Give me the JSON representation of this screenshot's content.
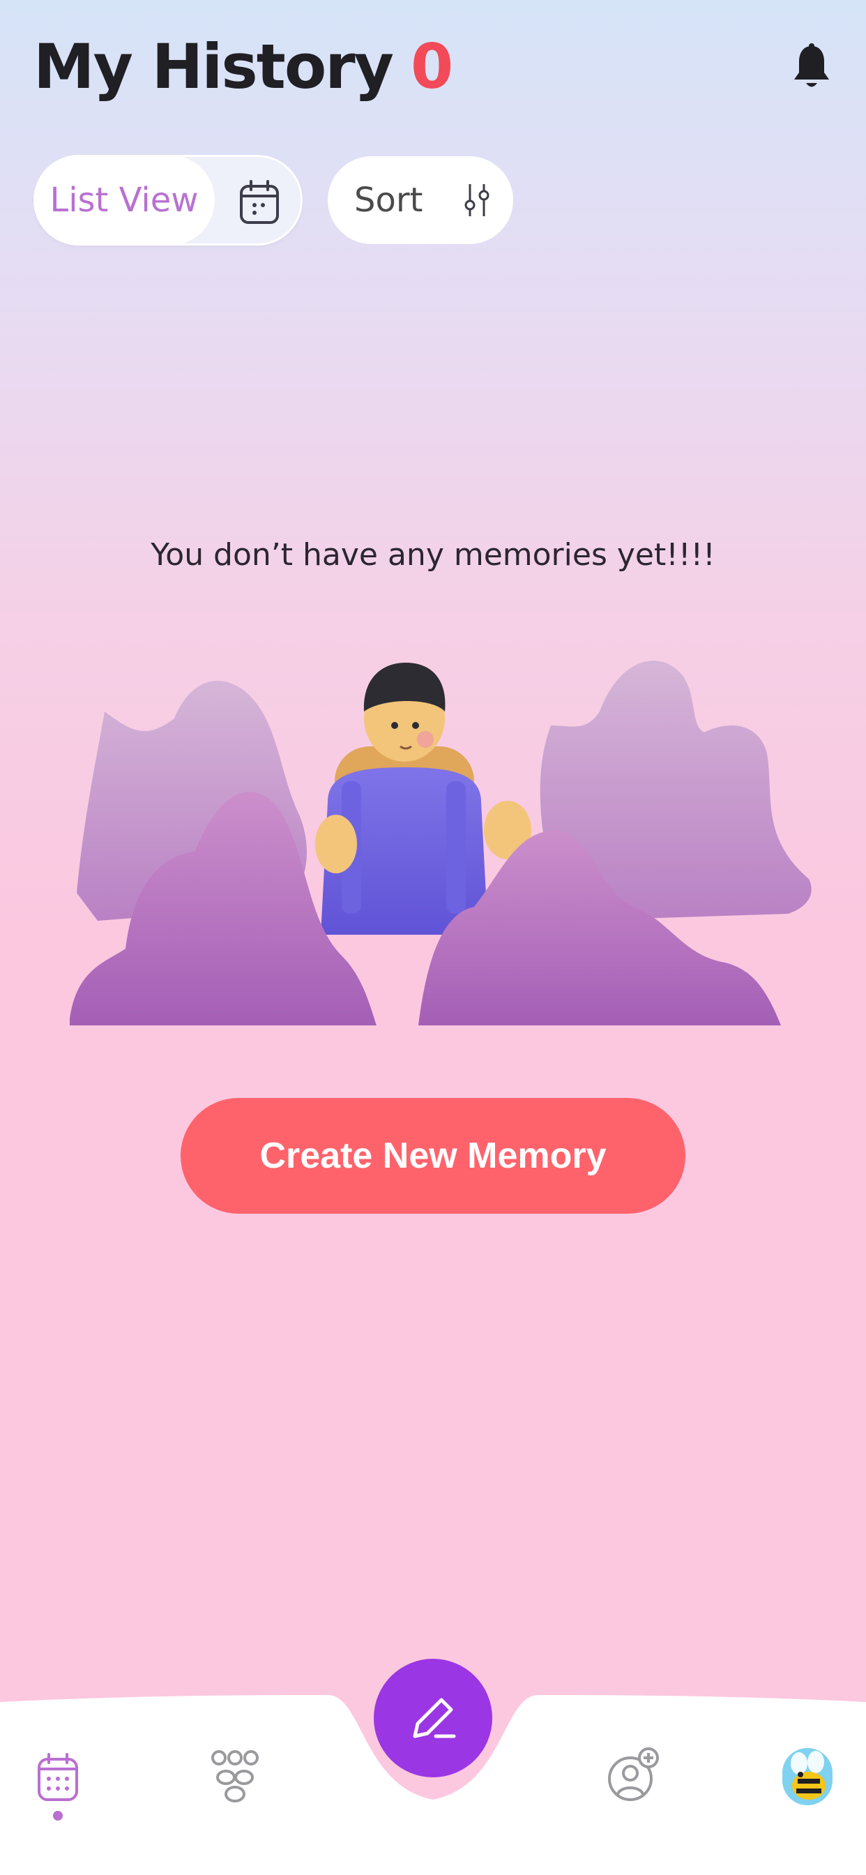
{
  "header": {
    "title": "My History",
    "count": "0"
  },
  "toolbar": {
    "view_label": "List View",
    "sort_label": "Sort"
  },
  "empty_state": {
    "message": "You don’t have any memories yet!!!!",
    "cta_label": "Create New Memory"
  },
  "colors": {
    "accent": "#b871d1",
    "count": "#f24a58",
    "cta": "#fe636c",
    "fab": "#9a36e3"
  },
  "icons": {
    "bell": "bell-icon",
    "calendar": "calendar-icon",
    "sliders": "sliders-icon",
    "nav_calendar": "calendar-icon",
    "nav_people": "people-icon",
    "nav_edit": "pencil-icon",
    "nav_add_user": "add-user-icon",
    "nav_avatar": "bee-avatar"
  }
}
